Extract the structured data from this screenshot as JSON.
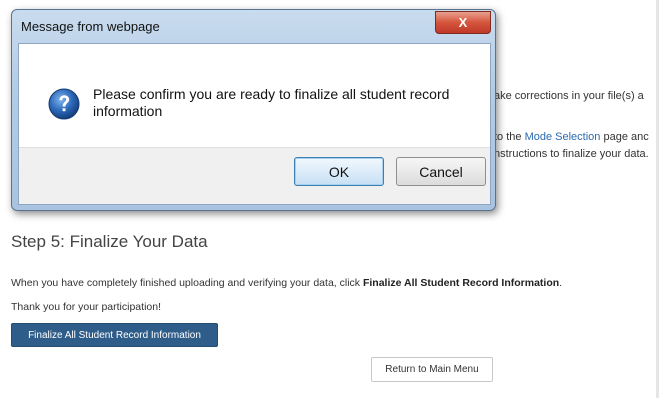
{
  "background": {
    "line1_fragment": "ake corrections in your file(s) a",
    "line2_prefix": "to the ",
    "line2_link": "Mode Selection",
    "line2_suffix": " page anc",
    "line3_fragment": "nstructions to finalize your data.",
    "step_title": "Step 5: Finalize Your Data",
    "para1_prefix": "When you have completely finished uploading and verifying your data, click ",
    "para1_bold": "Finalize All Student Record Information",
    "para1_suffix": ".",
    "para2": "Thank you for your participation!",
    "finalize_button": "Finalize All Student Record Information",
    "return_button": "Return to Main Menu"
  },
  "dialog": {
    "title": "Message from webpage",
    "close_glyph": "X",
    "icon": "question-icon",
    "message": "Please confirm you are ready to finalize all student record information",
    "ok_label": "OK",
    "cancel_label": "Cancel"
  },
  "colors": {
    "link": "#2a6bb0",
    "primary_button": "#2f5d8a",
    "close_button": "#c0392b"
  }
}
